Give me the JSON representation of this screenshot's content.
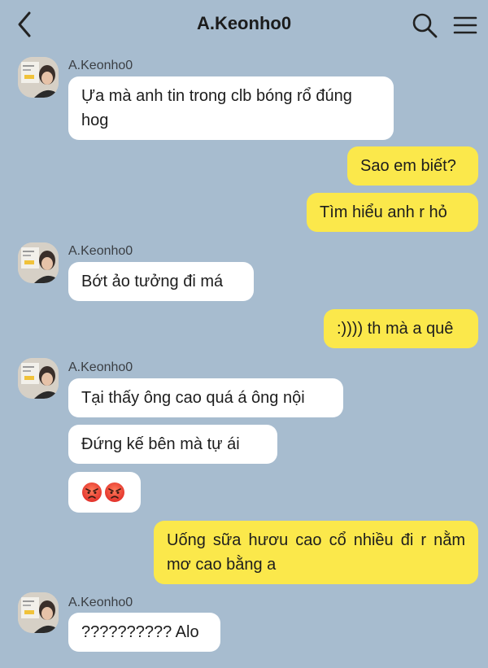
{
  "header": {
    "title": "A.Keonho0",
    "icons": {
      "back": "chevron-left-icon",
      "search": "search-icon",
      "menu": "hamburger-menu-icon"
    }
  },
  "chat": {
    "contact_name": "A.Keonho0",
    "messages": [
      {
        "side": "in",
        "text": "Ựa mà anh tin trong clb bóng rổ đúng hog"
      },
      {
        "side": "out",
        "text": "Sao em biết?"
      },
      {
        "side": "out",
        "text": "Tìm hiểu anh r hỏ"
      },
      {
        "side": "in",
        "text": "Bớt ảo tưởng đi má"
      },
      {
        "side": "out",
        "text": ":)))) th mà a quê"
      },
      {
        "side": "in",
        "text": "Tại thấy ông cao quá á ông nội"
      },
      {
        "side": "in",
        "text": "Đứng kế bên mà tự ái"
      },
      {
        "side": "in",
        "type": "emoji",
        "emoji": "angry-face-icon",
        "count": 2
      },
      {
        "side": "out",
        "text": "Uống sữa hươu cao cổ nhiều đi r nằm mơ cao bằng a"
      },
      {
        "side": "in",
        "text": "?????????? Alo"
      }
    ]
  },
  "colors": {
    "background": "#a7bccf",
    "incoming_bubble": "#ffffff",
    "outgoing_bubble": "#fbe84b"
  }
}
